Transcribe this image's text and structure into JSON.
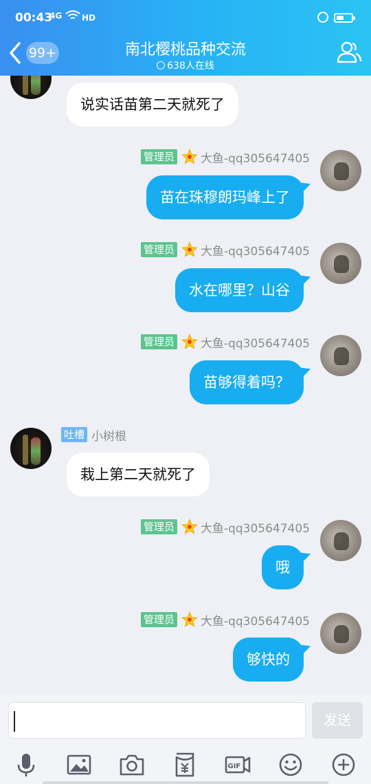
{
  "status_bar": {
    "time": "00:43",
    "signal": "4G",
    "hd": "HD"
  },
  "header": {
    "unread_count": "99+",
    "title": "南北樱桃品种交流",
    "online": "638人在线",
    "back_icon": "chevron-left-icon",
    "members_icon": "people-icon",
    "color_from": "#3a8ff0",
    "color_to": "#2bc3f4"
  },
  "messages": [
    {
      "side": "left",
      "text": "说实话苗第二天就死了"
    },
    {
      "side": "right",
      "role": "管理员",
      "name": "大鱼-qq305647405",
      "text": "苗在珠穆朗玛峰上了"
    },
    {
      "side": "right",
      "role": "管理员",
      "name": "大鱼-qq305647405",
      "text": "水在哪里？山谷"
    },
    {
      "side": "right",
      "role": "管理员",
      "name": "大鱼-qq305647405",
      "text": "苗够得着吗？"
    },
    {
      "side": "left",
      "role": "吐槽",
      "name": "小树根",
      "text": "栽上第二天就死了"
    },
    {
      "side": "right",
      "role": "管理员",
      "name": "大鱼-qq305647405",
      "text": "哦"
    },
    {
      "side": "right",
      "role": "管理员",
      "name": "大鱼-qq305647405",
      "text": "够快的"
    }
  ],
  "input": {
    "value": "",
    "send_label": "发送"
  },
  "toolbar": [
    {
      "icon": "microphone-icon"
    },
    {
      "icon": "image-icon"
    },
    {
      "icon": "camera-icon"
    },
    {
      "icon": "red-packet-icon"
    },
    {
      "icon": "gif-icon"
    },
    {
      "icon": "emoji-icon"
    },
    {
      "icon": "plus-icon"
    }
  ],
  "colors": {
    "bubble_self": "#18adf0",
    "bubble_other": "#ffffff",
    "admin_tag": "#5dc48f",
    "roast_tag": "#6fb4f6"
  }
}
